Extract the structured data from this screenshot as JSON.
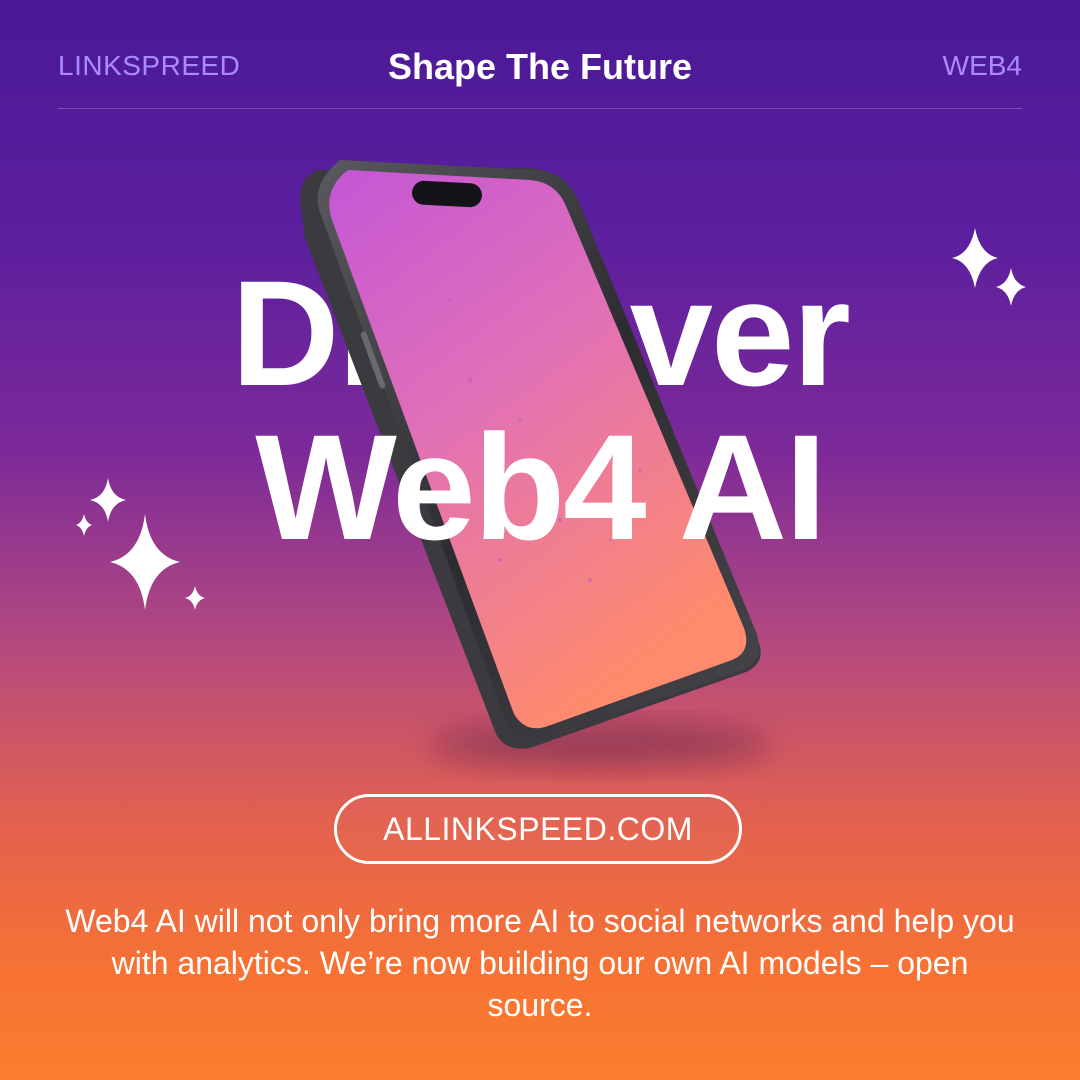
{
  "header": {
    "brand": "LINKSPREED",
    "tagline": "Shape The Future",
    "version": "WEB4"
  },
  "hero": {
    "line1": "Discover",
    "line2": "Web4 AI"
  },
  "cta": {
    "url_label": "ALLINKSPEED.COM"
  },
  "description": "Web4 AI will not only bring more AI to social networks and help you with analytics. We’re now building our own AI models – open source.",
  "colors": {
    "background_top": "#4a1996",
    "background_bottom": "#fb7d2e",
    "accent_label": "#a98bff",
    "text": "#ffffff"
  },
  "icons": [
    "sparkle-icon",
    "smartphone-illustration"
  ]
}
